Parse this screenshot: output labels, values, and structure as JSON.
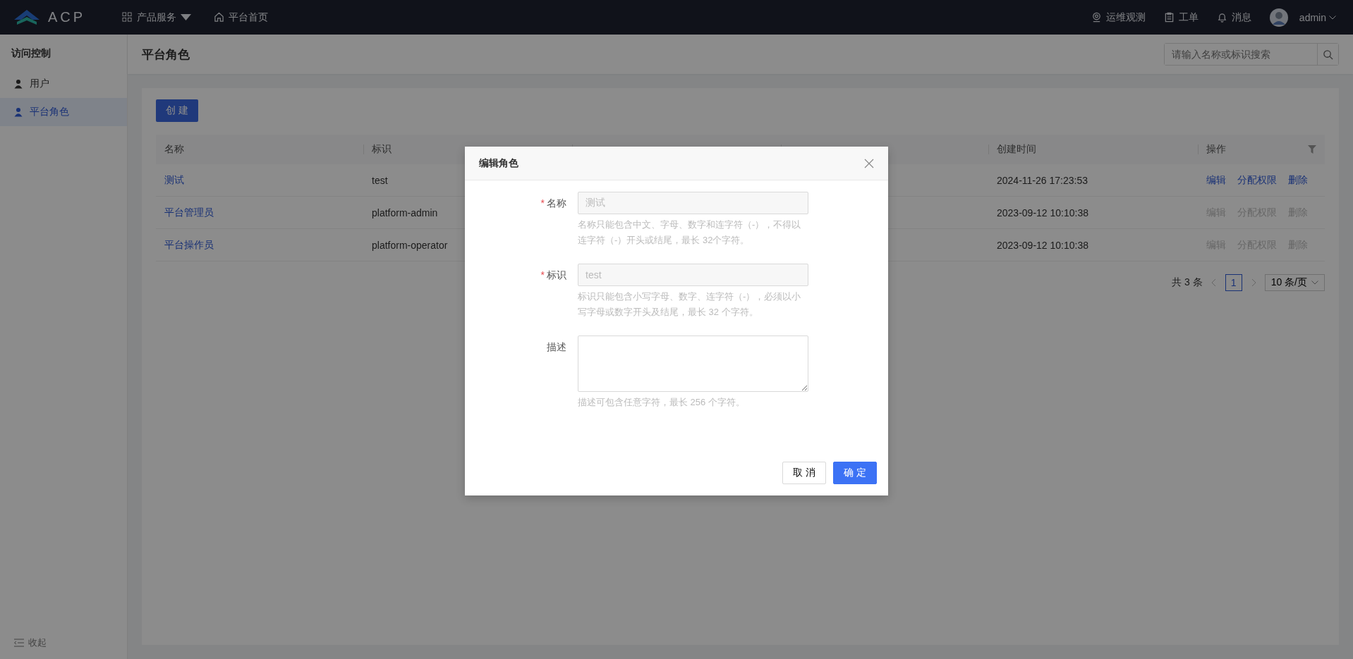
{
  "topbar": {
    "logo": "ACP",
    "nav": [
      {
        "label": "产品服务",
        "kind": "dropdown"
      },
      {
        "label": "平台首页",
        "kind": "home"
      }
    ],
    "actions": [
      {
        "label": "运维观测",
        "kind": "monitor"
      },
      {
        "label": "工单",
        "kind": "ticket"
      },
      {
        "label": "消息",
        "kind": "bell"
      }
    ],
    "user": "admin"
  },
  "sidebar": {
    "title": "访问控制",
    "items": [
      {
        "label": "用户",
        "selected": false
      },
      {
        "label": "平台角色",
        "selected": true
      }
    ],
    "collapse": "收起"
  },
  "page": {
    "title": "平台角色",
    "search": {
      "placeholder": "请输入名称或标识搜索"
    },
    "create_button": "创 建"
  },
  "table": {
    "columns": [
      "名称",
      "标识",
      "创建时间",
      "操作"
    ],
    "rows": [
      {
        "name": "测试",
        "id": "test",
        "created": "2024-11-26 17:23:53",
        "actions": [
          "编辑",
          "分配权限",
          "删除"
        ],
        "disabled": false
      },
      {
        "name": "平台管理员",
        "id": "platform-admin",
        "created": "2023-09-12 10:10:38",
        "actions": [
          "编辑",
          "分配权限",
          "删除"
        ],
        "disabled": true
      },
      {
        "name": "平台操作员",
        "id": "platform-operator",
        "created": "2023-09-12 10:10:38",
        "actions": [
          "编辑",
          "分配权限",
          "删除"
        ],
        "disabled": true
      }
    ]
  },
  "pagination": {
    "total": "共 3 条",
    "pages": [
      {
        "label": "1",
        "selected": true
      }
    ],
    "page_size": "10 条/页"
  },
  "modal": {
    "title": "编辑角色",
    "fields": [
      {
        "label": "名称",
        "required_mark": "*",
        "kind": "input",
        "value": "测试",
        "disabled": true,
        "hint": "名称只能包含中文、字母、数字和连字符（-），不得以连字符（-）开头或结尾，最长 32个字符。"
      },
      {
        "label": "标识",
        "required_mark": "*",
        "kind": "input",
        "value": "test",
        "disabled": true,
        "hint": "标识只能包含小写字母、数字、连字符（-），必须以小写字母或数字开头及结尾，最长 32 个字符。"
      },
      {
        "label": "描述",
        "kind": "textarea",
        "hint": "描述可包含任意字符，最长 256 个字符。"
      }
    ],
    "buttons": [
      {
        "label": "取 消",
        "kind": "default"
      },
      {
        "label": "确 定",
        "kind": "primary"
      }
    ]
  }
}
